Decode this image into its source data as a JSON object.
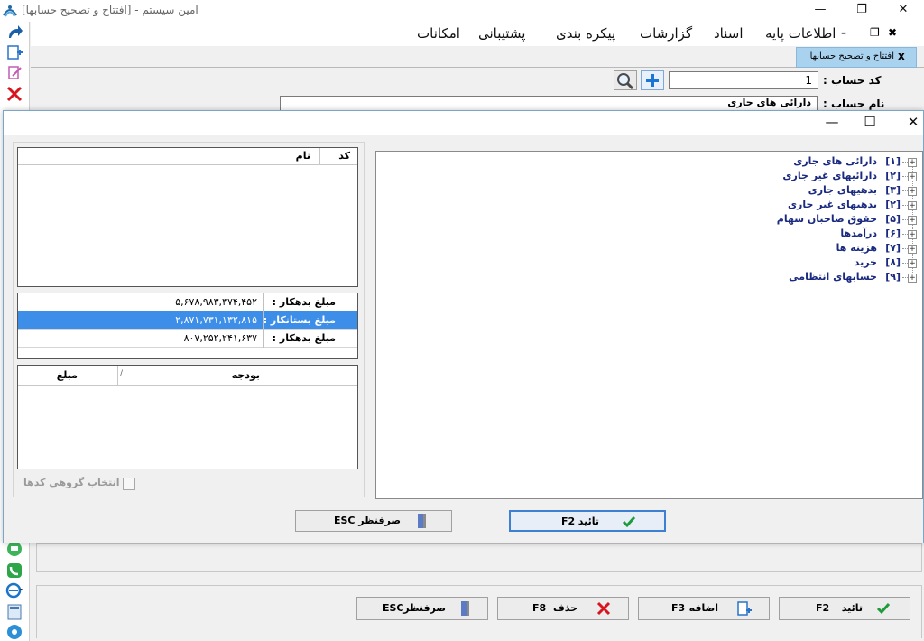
{
  "app": {
    "title": "امین سیستم - [افتتاح و تصحیح حسابها]"
  },
  "menu": {
    "items": [
      "اطلاعات پایه",
      "اسناد",
      "گزارشات",
      "پیکره بندی",
      "پشتیبانی",
      "امکانات"
    ]
  },
  "doc_tab": {
    "label": "افتتاح و تصحیح حسابها",
    "close": "x"
  },
  "form": {
    "code_label": "کد حساب :",
    "code_value": "1",
    "name_label": "نام حساب :",
    "name_value": "دارائی های جاری"
  },
  "dialog": {
    "grid1": {
      "col_code": "کد",
      "col_name": "نام"
    },
    "balances": [
      {
        "label": "مبلغ بدهکار :",
        "value": "۵,۶۷۸,۹۸۳,۳۷۴,۴۵۲",
        "selected": false
      },
      {
        "label": "مبلغ بستانکار :",
        "value": "۲,۸۷۱,۷۳۱,۱۳۲,۸۱۵",
        "selected": true
      },
      {
        "label": "مبلغ بدهکار :",
        "value": "۸۰۷,۲۵۲,۲۴۱,۶۳۷",
        "selected": false
      }
    ],
    "grid3": {
      "col_budget": "بودجه",
      "col_amount": "مبلغ",
      "sort_mark": "/"
    },
    "group_select_label": "انتخاب گروهی کدها",
    "tree": [
      {
        "code": "[۱]",
        "name": "دارائی های جاری"
      },
      {
        "code": "[۲]",
        "name": "دارائیهای غیر جاری"
      },
      {
        "code": "[۳]",
        "name": "بدهیهای جاری"
      },
      {
        "code": "[۲]",
        "name": "بدهیهای غیر جاری"
      },
      {
        "code": "[۵]",
        "name": "حقوق صاحبان سهام"
      },
      {
        "code": "[۶]",
        "name": "درآمدها"
      },
      {
        "code": "[۷]",
        "name": "هزینه ها"
      },
      {
        "code": "[۸]",
        "name": "خرید"
      },
      {
        "code": "[۹]",
        "name": "حسابهای انتظامی"
      }
    ],
    "confirm_label": "تائید",
    "confirm_key": "F2",
    "cancel_label": "صرفنظر",
    "cancel_key": "ESC"
  },
  "footer": {
    "confirm_label": "تائید",
    "confirm_key": "F2",
    "add_label": "اضافه",
    "add_key": "F3",
    "delete_label": "حذف",
    "delete_key": "F8",
    "cancel_label": "صرفنظر",
    "cancel_key": "ESC"
  },
  "colors": {
    "selection": "#3d8ee8",
    "tree_text": "#1a2a80",
    "tab_active": "#a9d2ef",
    "confirm_border": "#3d7fd1"
  }
}
